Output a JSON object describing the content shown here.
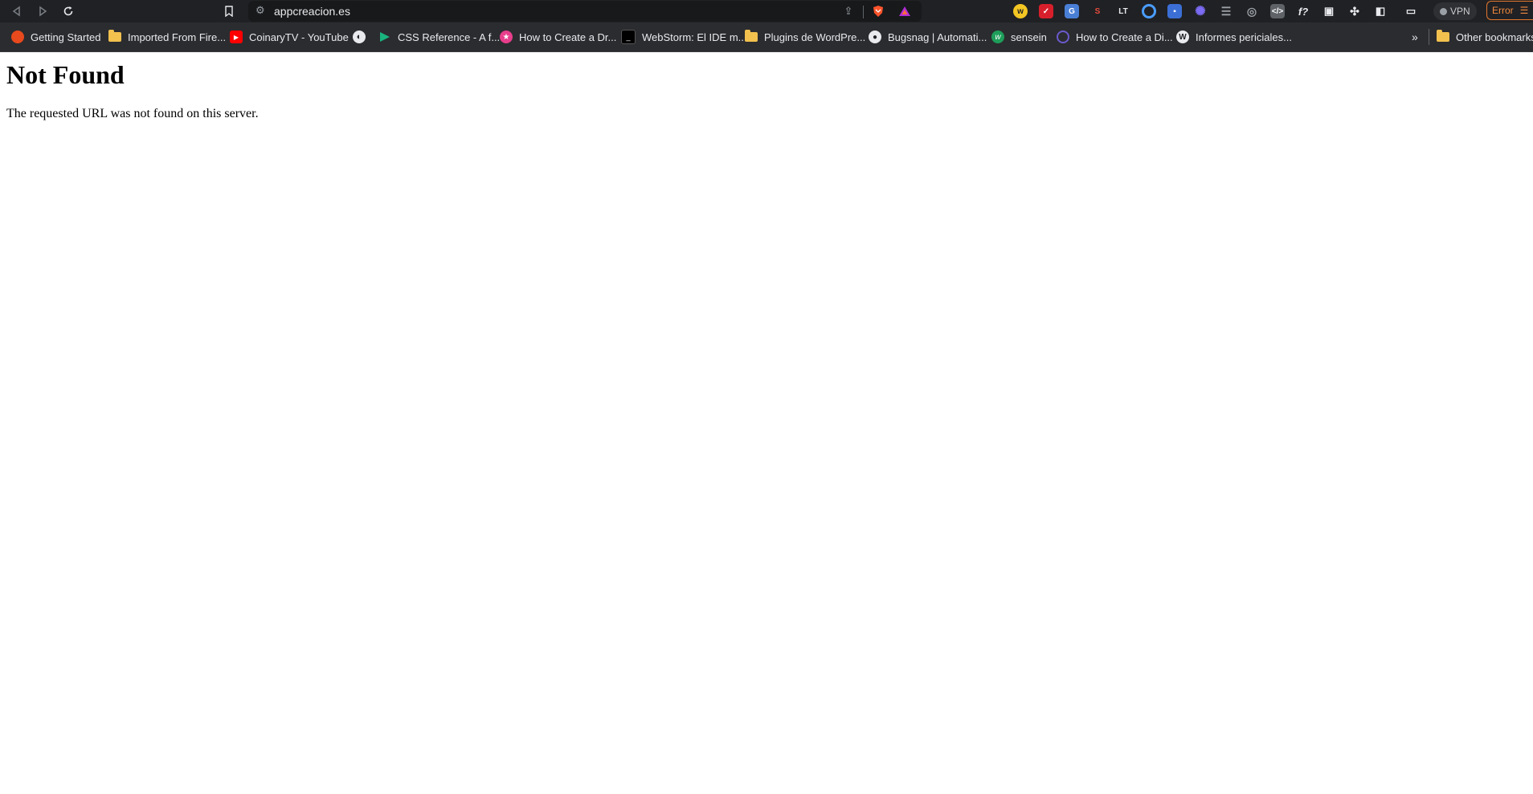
{
  "browser": {
    "url": "appcreacion.es",
    "vpn_label": "VPN",
    "error_label": "Error",
    "bookmarks": [
      {
        "label": "Getting Started",
        "icon": "firefox-icon",
        "color": "#e8491d"
      },
      {
        "label": "Imported From Fire...",
        "icon": "folder-icon",
        "color": "#f2c14e"
      },
      {
        "label": "CoinaryTV - YouTube",
        "icon": "youtube-icon",
        "color": "#ff0000"
      },
      {
        "label": "",
        "icon": "globe-icon",
        "color": "#e8eaed"
      },
      {
        "label": "CSS Reference - A f...",
        "icon": "css-reference-icon",
        "color": "#19b37e"
      },
      {
        "label": "How to Create a Dr...",
        "icon": "pink-star-icon",
        "color": "#e83e8c"
      },
      {
        "label": "WebStorm: El IDE m...",
        "icon": "webstorm-icon",
        "color": "#000000"
      },
      {
        "label": "Plugins de WordPre...",
        "icon": "folder-icon",
        "color": "#f2c14e"
      },
      {
        "label": "Bugsnag | Automati...",
        "icon": "bugsnag-icon",
        "color": "#e8eaed"
      },
      {
        "label": "sensein",
        "icon": "sensein-icon",
        "color": "#1e9e5a"
      },
      {
        "label": "How to Create a Di...",
        "icon": "circle-logo-icon",
        "color": "#6a5acd"
      },
      {
        "label": "Informes periciales...",
        "icon": "wordpress-icon",
        "color": "#e8eaed"
      }
    ],
    "other_bookmarks_label": "Other bookmarks"
  },
  "page": {
    "heading": "Not Found",
    "message": "The requested URL was not found on this server."
  }
}
